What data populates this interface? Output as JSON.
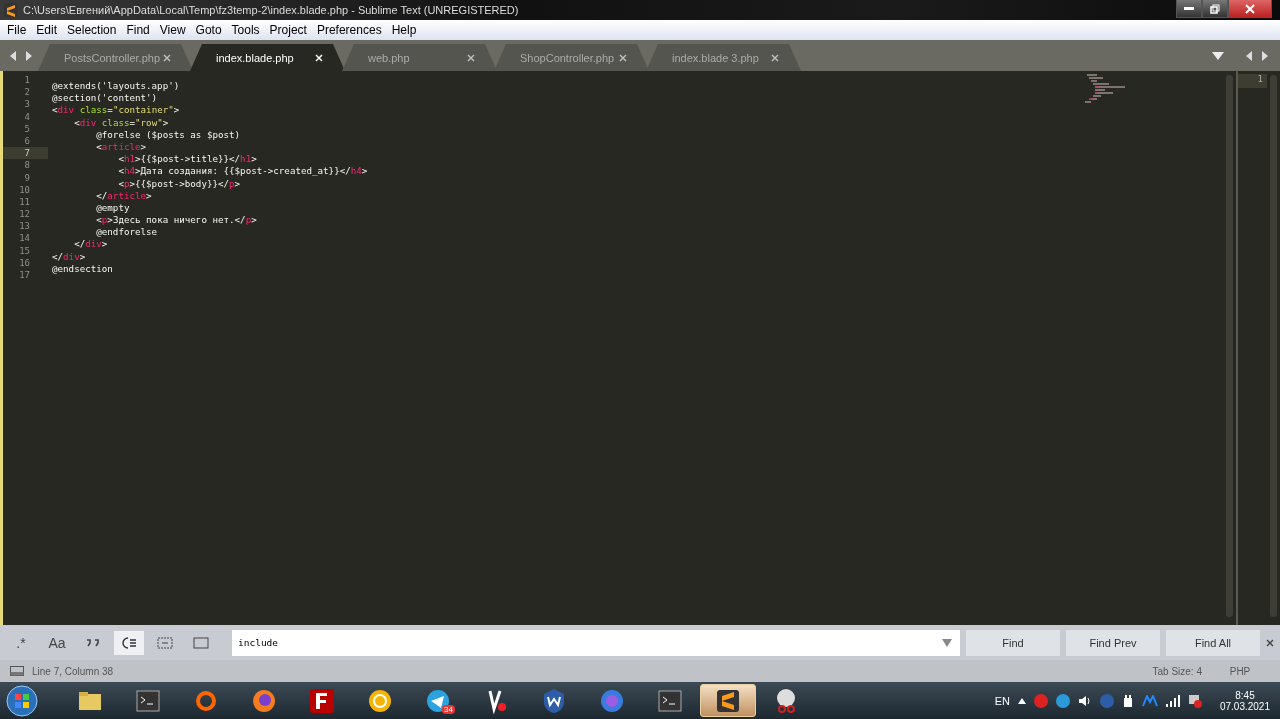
{
  "window": {
    "title": "C:\\Users\\Евгений\\AppData\\Local\\Temp\\fz3temp-2\\index.blade.php - Sublime Text (UNREGISTERED)"
  },
  "menu": [
    "File",
    "Edit",
    "Selection",
    "Find",
    "View",
    "Goto",
    "Tools",
    "Project",
    "Preferences",
    "Help"
  ],
  "tabs": [
    {
      "label": "PostsController.php",
      "selected": false
    },
    {
      "label": "index.blade.php",
      "selected": true
    },
    {
      "label": "web.php",
      "selected": false
    },
    {
      "label": "ShopController.php",
      "selected": false
    },
    {
      "label": "index.blade 3.php",
      "selected": false
    }
  ],
  "editor": {
    "lines": [
      {
        "number": "1",
        "current": false,
        "tokens": [
          {
            "kind": "plain",
            "text": "@extends('layouts.app')"
          }
        ]
      },
      {
        "number": "2",
        "current": false,
        "tokens": [
          {
            "kind": "plain",
            "text": "@section('content')"
          }
        ]
      },
      {
        "number": "3",
        "current": false,
        "tokens": [
          {
            "kind": "plain",
            "text": "<"
          },
          {
            "kind": "tag",
            "text": "div"
          },
          {
            "kind": "attr",
            "text": " class"
          },
          {
            "kind": "plain",
            "text": "="
          },
          {
            "kind": "string",
            "text": "\"container\""
          },
          {
            "kind": "plain",
            "text": ">"
          }
        ]
      },
      {
        "number": "4",
        "current": false,
        "tokens": [
          {
            "kind": "plain",
            "text": "    <"
          },
          {
            "kind": "tag",
            "text": "div"
          },
          {
            "kind": "attr",
            "text": " class"
          },
          {
            "kind": "plain",
            "text": "="
          },
          {
            "kind": "string",
            "text": "\"row\""
          },
          {
            "kind": "plain",
            "text": ">"
          }
        ]
      },
      {
        "number": "5",
        "current": false,
        "tokens": [
          {
            "kind": "plain",
            "text": "        @forelse ($posts as $post)"
          }
        ]
      },
      {
        "number": "6",
        "current": false,
        "tokens": [
          {
            "kind": "plain",
            "text": "        <"
          },
          {
            "kind": "tag",
            "text": "article"
          },
          {
            "kind": "plain",
            "text": ">"
          }
        ]
      },
      {
        "number": "7",
        "current": true,
        "tokens": [
          {
            "kind": "plain",
            "text": "            <"
          },
          {
            "kind": "tag",
            "text": "h1"
          },
          {
            "kind": "plain",
            "text": ">{{$post->title}}</"
          },
          {
            "kind": "tag",
            "text": "h1"
          },
          {
            "kind": "plain",
            "text": ">"
          }
        ]
      },
      {
        "number": "8",
        "current": false,
        "tokens": [
          {
            "kind": "plain",
            "text": "            <"
          },
          {
            "kind": "tag",
            "text": "h4"
          },
          {
            "kind": "plain",
            "text": ">Дата создания: {{$post->created_at}}</"
          },
          {
            "kind": "tag",
            "text": "h4"
          },
          {
            "kind": "plain",
            "text": ">"
          }
        ]
      },
      {
        "number": "9",
        "current": false,
        "tokens": [
          {
            "kind": "plain",
            "text": "            <"
          },
          {
            "kind": "tag",
            "text": "p"
          },
          {
            "kind": "plain",
            "text": ">{{$post->body}}</"
          },
          {
            "kind": "tag",
            "text": "p"
          },
          {
            "kind": "plain",
            "text": ">"
          }
        ]
      },
      {
        "number": "10",
        "current": false,
        "tokens": [
          {
            "kind": "plain",
            "text": "        </"
          },
          {
            "kind": "tag",
            "text": "article"
          },
          {
            "kind": "plain",
            "text": ">"
          }
        ]
      },
      {
        "number": "11",
        "current": false,
        "tokens": [
          {
            "kind": "plain",
            "text": "        @empty"
          }
        ]
      },
      {
        "number": "12",
        "current": false,
        "tokens": [
          {
            "kind": "plain",
            "text": "        <"
          },
          {
            "kind": "tag",
            "text": "p"
          },
          {
            "kind": "plain",
            "text": ">Здесь пока ничего нет.</"
          },
          {
            "kind": "tag",
            "text": "p"
          },
          {
            "kind": "plain",
            "text": ">"
          }
        ]
      },
      {
        "number": "13",
        "current": false,
        "tokens": [
          {
            "kind": "plain",
            "text": "        @endforelse"
          }
        ]
      },
      {
        "number": "14",
        "current": false,
        "tokens": [
          {
            "kind": "plain",
            "text": "    </"
          },
          {
            "kind": "tag",
            "text": "div"
          },
          {
            "kind": "plain",
            "text": ">"
          }
        ]
      },
      {
        "number": "15",
        "current": false,
        "tokens": [
          {
            "kind": "plain",
            "text": "</"
          },
          {
            "kind": "tag",
            "text": "div"
          },
          {
            "kind": "plain",
            "text": ">"
          }
        ]
      },
      {
        "number": "16",
        "current": false,
        "tokens": [
          {
            "kind": "plain",
            "text": "@endsection"
          }
        ]
      },
      {
        "number": "17",
        "current": false
      }
    ],
    "side_pane_line": "1"
  },
  "find_panel": {
    "toggles": [
      {
        "kind": "text",
        "text": ".*",
        "selected": false
      },
      {
        "kind": "text",
        "text": "Aa",
        "selected": false
      },
      {
        "kind": "quotes",
        "selected": false
      },
      {
        "kind": "wrap",
        "selected": true
      },
      {
        "kind": "selection",
        "selected": false
      },
      {
        "kind": "highlight",
        "selected": false
      }
    ],
    "value": "include",
    "buttons": [
      "Find",
      "Find Prev",
      "Find All"
    ]
  },
  "status_bar": {
    "position": "Line 7, Column 38",
    "tab_size": "Tab Size: 4",
    "syntax": "PHP"
  },
  "taskbar": {
    "apps": [
      {
        "kind": "folder",
        "selected": false
      },
      {
        "kind": "terminal",
        "selected": false
      },
      {
        "kind": "ring",
        "selected": false
      },
      {
        "kind": "firefox",
        "selected": false
      },
      {
        "kind": "filezilla",
        "selected": false
      },
      {
        "kind": "circle",
        "selected": false
      },
      {
        "kind": "telegram",
        "selected": false,
        "badge": "34"
      },
      {
        "kind": "vpn",
        "selected": false
      },
      {
        "kind": "w",
        "selected": false
      },
      {
        "kind": "globe",
        "selected": false
      },
      {
        "kind": "terminal",
        "selected": false
      },
      {
        "kind": "sublime",
        "selected": true
      },
      {
        "kind": "snip",
        "selected": false
      }
    ],
    "language": "EN",
    "time": "8:45",
    "date": "07.03.2021"
  }
}
